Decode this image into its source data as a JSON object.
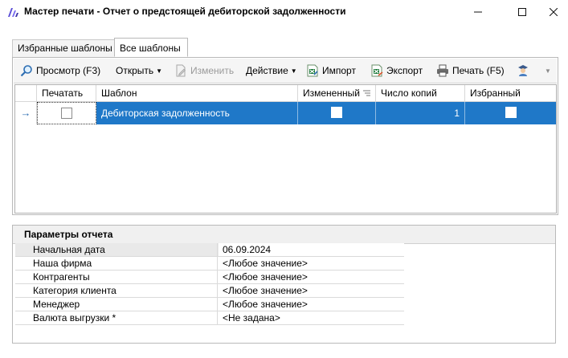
{
  "window": {
    "title": "Мастер печати - Отчет о предстоящей дебиторской задолженности",
    "colors": {
      "selection": "#1f78c8",
      "title_icon": "#5b4fd6"
    }
  },
  "tabs": [
    {
      "label": "Избранные шаблоны",
      "active": false
    },
    {
      "label": "Все шаблоны",
      "active": true
    }
  ],
  "toolbar": {
    "preview": "Просмотр (F3)",
    "open": "Открыть",
    "edit": "Изменить",
    "action": "Действие",
    "import": "Импорт",
    "export": "Экспорт",
    "print": "Печать (F5)"
  },
  "grid": {
    "columns": [
      "Печатать",
      "Шаблон",
      "Измененный",
      "Число копий",
      "Избранный"
    ],
    "rows": [
      {
        "print": false,
        "template": "Дебиторская задолженность",
        "modified": false,
        "copies": "1",
        "favorite": false,
        "selected": true
      }
    ]
  },
  "params": {
    "title": "Параметры отчета",
    "rows": [
      {
        "name": "Начальная дата",
        "value": "06.09.2024"
      },
      {
        "name": "Наша фирма",
        "value": "<Любое значение>"
      },
      {
        "name": "Контрагенты",
        "value": "<Любое значение>"
      },
      {
        "name": "Категория клиента",
        "value": "<Любое значение>"
      },
      {
        "name": "Менеджер",
        "value": "<Любое значение>"
      },
      {
        "name": "Валюта выгрузки *",
        "value": "<Не задана>"
      }
    ]
  }
}
